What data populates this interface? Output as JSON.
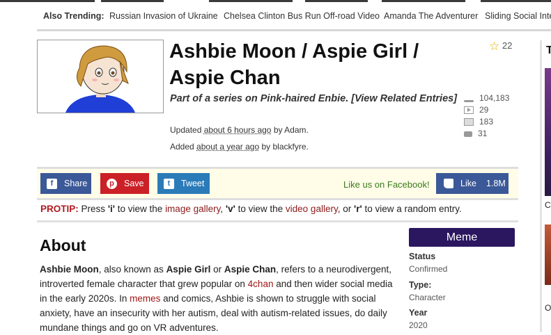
{
  "trending": {
    "label": "Also Trending:",
    "items": [
      "Russian Invasion of Ukraine",
      "Chelsea Clinton Bus Run Off-road Video",
      "Amanda The Adventurer",
      "Sliding Social Inte"
    ]
  },
  "entry": {
    "title": "Ashbie Moon / Aspie Girl / Aspie Chan",
    "series_text": "Part of a series on Pink-haired Enbie. [View Related Entries]",
    "updated_prefix": "Updated",
    "updated_time": "about 6 hours ago",
    "updated_by": "by Adam.",
    "added_prefix": "Added",
    "added_time": "about a year ago",
    "added_by": "by blackfyre.",
    "favorites": "22",
    "stats": {
      "views": "104,183",
      "videos": "29",
      "images": "183",
      "comments": "31"
    }
  },
  "share": {
    "facebook": "Share",
    "pinterest": "Save",
    "twitter": "Tweet",
    "like_us": "Like us on Facebook!",
    "like": "Like",
    "like_count": "1.8M"
  },
  "protip": {
    "label": "PROTIP:",
    "t1": "Press",
    "k1": "'i'",
    "t2": "to view the",
    "l1": "image gallery",
    "t3": ",",
    "k2": "'v'",
    "t4": "to view the",
    "l2": "video gallery",
    "t5": ", or",
    "k3": "'r'",
    "t6": "to view a random entry."
  },
  "about": {
    "heading": "About",
    "p1_b1": "Ashbie Moon",
    "p1_t1": ", also known as ",
    "p1_b2": "Aspie Girl",
    "p1_t2": " or ",
    "p1_b3": "Aspie Chan",
    "p1_t3": ", refers to a neurodivergent, introverted female character that grew popular on ",
    "p1_l1": "4chan",
    "p1_t4": " and then wider social media in the early 2020s. In ",
    "p1_l2": "memes",
    "p1_t5": " and comics, Ashbie is shown to struggle with social anxiety, have an insecurity with her autism, deal with autism-related issues, do daily mundane things and go on VR adventures."
  },
  "details": {
    "kind": "Meme",
    "status_label": "Status",
    "status_value": "Confirmed",
    "type_label": "Type:",
    "type_value": "Character",
    "year_label": "Year",
    "year_value": "2020"
  },
  "sidebar": {
    "title": "Te",
    "cap1": "Ca",
    "cap2": "Ov"
  }
}
